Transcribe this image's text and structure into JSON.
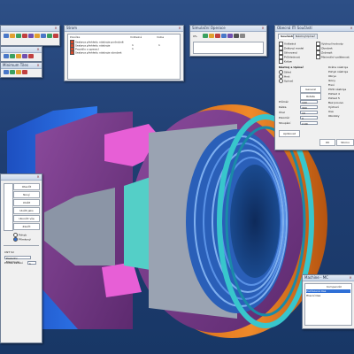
{
  "colors": {
    "desktop": "#1f3e72",
    "outer_ring": "#1c5fd8",
    "purple": "#7d3e8c",
    "orange": "#e07a1c",
    "pink": "#e75fd6",
    "teal": "#54cfc7",
    "cyan": "#2fd6d6",
    "thread_blue": "#3d7bd8",
    "gray": "#8b95a6"
  },
  "windows": {
    "toolbar_a": {
      "title": "",
      "icons": [
        "select-icon",
        "move-icon",
        "rotate-icon",
        "zoom-icon",
        "pan-icon",
        "fit-icon",
        "box-icon",
        "sphere-icon",
        "cylinder-icon"
      ]
    },
    "toolbar_b": {
      "title": ""
    },
    "toolbar_c": {
      "title": "Minimum Tiles"
    },
    "strom": {
      "title": "Strom",
      "headers": [
        "Položka",
        "Viditelná",
        "Volba"
      ],
      "rows": [
        {
          "name": "Sestava přehledu nástroje podrobně",
          "vis": "",
          "sel": ""
        },
        {
          "name": "Sestava přehledu nástroje",
          "vis": "1",
          "sel": "1"
        },
        {
          "name": "Pravidlo s operací",
          "vis": "1",
          "sel": ""
        },
        {
          "name": "Sestava přehledu nástroje obrobek",
          "vis": "",
          "sel": ""
        }
      ]
    },
    "simulace": {
      "title": "Simulační Operace",
      "speed": "0%",
      "icons": [
        "play-icon",
        "pause-icon",
        "stop-icon",
        "step-icon",
        "rewind-icon",
        "camera-icon",
        "settings-icon"
      ]
    },
    "props": {
      "title": "Obecná ITI Součástí",
      "tabs": [
        "Součástí",
        "Nástroj/Upínač"
      ],
      "checkboxes": [
        "Viditelná",
        "Drátový model",
        "Stínovaný",
        "Průhlednost",
        "Kolize"
      ],
      "right_checks": [
        "Výchozí hodnoty",
        "Obrobek",
        "Zobrazit",
        "Minimální vzdálenost"
      ],
      "section_label": "Nástroj a Upínač",
      "radios": [
        "Střed",
        "Hrot",
        "Upínač"
      ],
      "rows": [
        {
          "label": "Průměr",
          "value": "100"
        },
        {
          "label": "Délka",
          "value": "300"
        },
        {
          "label": "Úhel",
          "value": "10"
        },
        {
          "label": "Poloměr",
          "value": "0"
        },
        {
          "label": "Stoupání",
          "value": "2.00"
        }
      ],
      "button_general": "General",
      "button_rotate": "Rotate",
      "button_apply": "Aplikovat",
      "right_options": [
        "Dráha nástroje",
        "Pohyb nástroje",
        "Obrys",
        "Ikony",
        "Fixní",
        "PIVO nástroje",
        "Pohled 4",
        "Pohled 5",
        "Bez posuvu",
        "Výchozí",
        "Osa",
        "Obrobky"
      ],
      "footer": [
        "OK",
        "Storno"
      ]
    },
    "left_panel": {
      "title": "",
      "buttons": [
        "Otevřít",
        "Nový",
        "Uložit",
        "Uložit jako",
        "Ukončit vše",
        "Zavřít"
      ],
      "radio_a": "Pohyb",
      "radio_b": "Přímkový",
      "field_label": "CNT Sil",
      "select_value": "Posledni Maximum",
      "field_label_2": "Proces zadání",
      "value_2": "1"
    },
    "machine": {
      "title": "Machine - MC",
      "headers": [
        "",
        "Kompenzát"
      ],
      "rows": [
        "Podřazená Osa",
        "Hlavní Osa"
      ],
      "selected_row": 0
    }
  }
}
